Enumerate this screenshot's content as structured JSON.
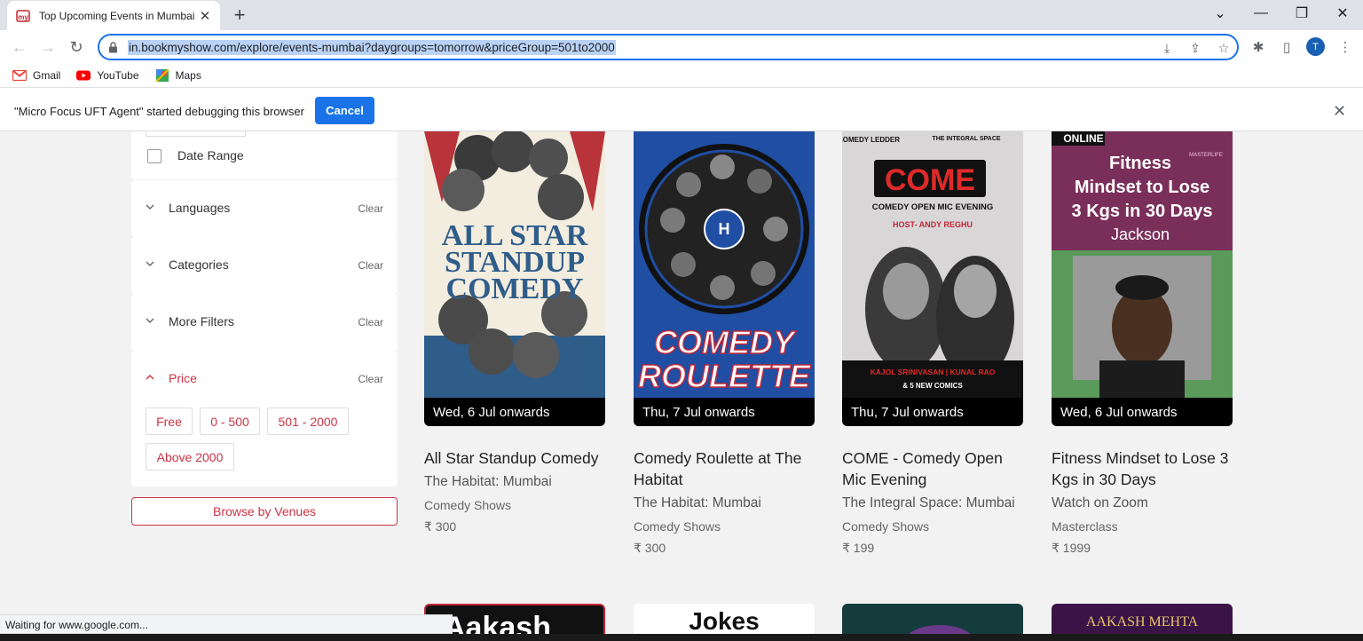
{
  "browser": {
    "tab_title": "Top Upcoming Events in Mumbai",
    "url": "in.bookmyshow.com/explore/events-mumbai?daygroups=tomorrow&priceGroup=501to2000",
    "profile_initial": "T",
    "bookmarks": [
      {
        "label": "Gmail",
        "icon": "gmail-icon"
      },
      {
        "label": "YouTube",
        "icon": "youtube-icon"
      },
      {
        "label": "Maps",
        "icon": "maps-icon"
      }
    ],
    "infobar_text": "\"Micro Focus UFT Agent\" started debugging this browser",
    "infobar_cancel": "Cancel",
    "status_text": "Waiting for www.google.com..."
  },
  "filters": {
    "date_range_label": "Date Range",
    "sections": [
      {
        "title": "Languages",
        "clear": "Clear",
        "expanded": false
      },
      {
        "title": "Categories",
        "clear": "Clear",
        "expanded": false
      },
      {
        "title": "More Filters",
        "clear": "Clear",
        "expanded": false
      },
      {
        "title": "Price",
        "clear": "Clear",
        "expanded": true
      }
    ],
    "price_options": [
      "Free",
      "0 - 500",
      "501 - 2000",
      "Above 2000"
    ],
    "browse_venues": "Browse by Venues"
  },
  "events": [
    {
      "poster_text": [
        "ALL STAR",
        "STANDUP",
        "COMEDY"
      ],
      "date": "Wed, 6 Jul onwards",
      "title": "All Star Standup Comedy",
      "venue": "The Habitat: Mumbai",
      "category": "Comedy Shows",
      "price": "₹ 300"
    },
    {
      "poster_text": [
        "COMEDY",
        "ROULETTE"
      ],
      "date": "Thu, 7 Jul onwards",
      "title": "Comedy Roulette at The Habitat",
      "venue": "The Habitat: Mumbai",
      "category": "Comedy Shows",
      "price": "₹ 300"
    },
    {
      "poster_text": [
        "COMEDY LEDDER",
        "THE INTEGRAL SPACE",
        "COME",
        "COMEDY OPEN MIC EVENING",
        "HOST- ANDY REGHU",
        "KAJOL SRINIVASAN | KUNAL RAO",
        "& 5 NEW COMICS"
      ],
      "date": "Thu, 7 Jul onwards",
      "title": "COME - Comedy Open Mic Evening",
      "venue": "The Integral Space: Mumbai",
      "category": "Comedy Shows",
      "price": "₹ 199"
    },
    {
      "poster_text": [
        "ONLINE",
        "MASTERLIFE",
        "Fitness",
        "Mindset to Lose",
        "3 Kgs in 30 Days",
        "Jackson"
      ],
      "date": "Wed, 6 Jul onwards",
      "title": "Fitness Mindset to Lose 3 Kgs in 30 Days",
      "venue": "Watch on Zoom",
      "category": "Masterclass",
      "price": "₹ 1999"
    }
  ],
  "next_row": [
    "Aakash",
    "Jokes",
    "",
    "AAKASH MEHTA"
  ]
}
